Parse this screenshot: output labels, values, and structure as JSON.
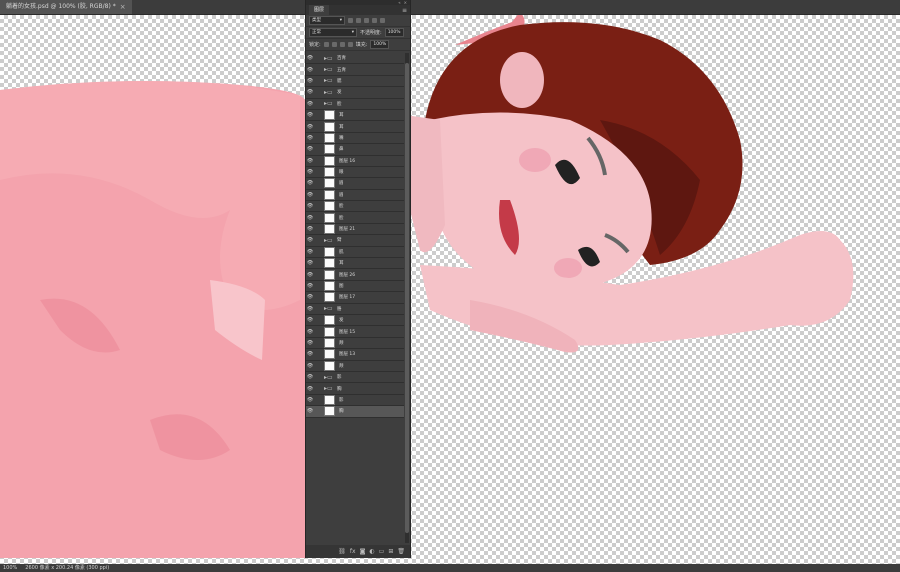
{
  "document": {
    "tab_title": "躺着的女孩.psd @ 100% (胶, RGB/8) *",
    "close_label": "×"
  },
  "status_bar": {
    "zoom": "100%",
    "doc_info": "2600 像素 x 200.24 像素 (300 ppi)"
  },
  "layers_panel": {
    "tab_label": "图层",
    "menu_icon": "≡",
    "filter_kind": "类型",
    "blend_mode": "正常",
    "opacity_label": "不透明度:",
    "opacity_value": "100%",
    "lock_label": "锁定:",
    "fill_label": "填充:",
    "fill_value": "100%",
    "layers": [
      {
        "name": "百青",
        "kind": "group"
      },
      {
        "name": "五青",
        "kind": "group"
      },
      {
        "name": "腮",
        "kind": "group"
      },
      {
        "name": "发",
        "kind": "group"
      },
      {
        "name": "脸",
        "kind": "group"
      },
      {
        "name": "耳",
        "kind": "layer"
      },
      {
        "name": "耳",
        "kind": "layer"
      },
      {
        "name": "嘴",
        "kind": "layer"
      },
      {
        "name": "鼻",
        "kind": "layer"
      },
      {
        "name": "图层 16",
        "kind": "layer"
      },
      {
        "name": "眼",
        "kind": "layer"
      },
      {
        "name": "眉",
        "kind": "layer"
      },
      {
        "name": "眉",
        "kind": "layer"
      },
      {
        "name": "脸",
        "kind": "layer"
      },
      {
        "name": "脸",
        "kind": "layer"
      },
      {
        "name": "图层 21",
        "kind": "layer"
      },
      {
        "name": "臂",
        "kind": "group"
      },
      {
        "name": "肌",
        "kind": "layer"
      },
      {
        "name": "耳",
        "kind": "layer"
      },
      {
        "name": "图层 26",
        "kind": "layer"
      },
      {
        "name": "图",
        "kind": "layer"
      },
      {
        "name": "图层 17",
        "kind": "layer"
      },
      {
        "name": "胳",
        "kind": "group"
      },
      {
        "name": "发",
        "kind": "layer"
      },
      {
        "name": "图层 15",
        "kind": "layer"
      },
      {
        "name": "颊",
        "kind": "layer"
      },
      {
        "name": "图层 13",
        "kind": "layer"
      },
      {
        "name": "颊",
        "kind": "layer"
      },
      {
        "name": "影",
        "kind": "group"
      },
      {
        "name": "胸",
        "kind": "group"
      },
      {
        "name": "影",
        "kind": "layer"
      },
      {
        "name": "胸",
        "kind": "layer",
        "selected": true
      }
    ],
    "bottom_icons": [
      "link-icon",
      "fx-icon",
      "mask-icon",
      "adjustment-icon",
      "folder-icon",
      "new-layer-icon",
      "trash-icon"
    ]
  }
}
